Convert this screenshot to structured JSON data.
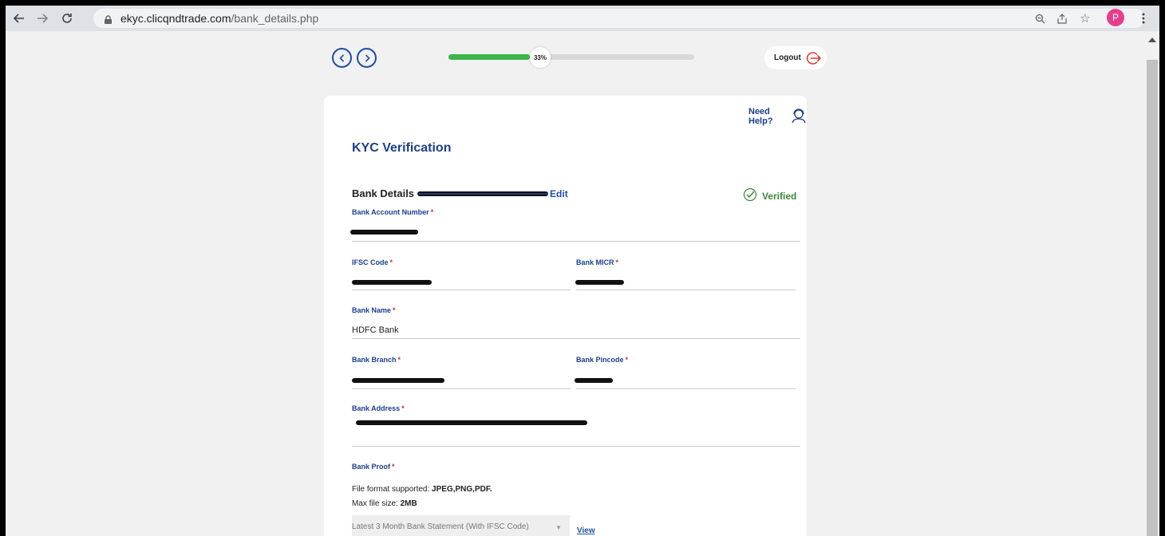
{
  "browser": {
    "url_domain": "ekyc.clicqndtrade.com",
    "url_path": "/bank_details.php",
    "profile_initial": "P"
  },
  "header": {
    "progress_percent": 33,
    "progress_label": "33%",
    "logout_label": "Logout"
  },
  "card": {
    "help_label": "Need Help?",
    "title": "KYC Verification",
    "section_title": "Bank Details",
    "edit_label": "Edit",
    "verified_label": "Verified",
    "fields": {
      "account_number_label": "Bank Account Number",
      "ifsc_label": "IFSC Code",
      "micr_label": "Bank MICR",
      "bank_name_label": "Bank Name",
      "bank_name_value": "HDFC Bank",
      "branch_label": "Bank Branch",
      "pincode_label": "Bank Pincode",
      "address_label": "Bank Address",
      "proof_label": "Bank Proof"
    },
    "file_info": {
      "format_prefix": "File format supported: ",
      "format_value": "JPEG,PNG,PDF.",
      "size_prefix": "Max file size: ",
      "size_value": "2MB"
    },
    "proof_select_value": "Latest 3 Month Bank Statement (With IFSC Code)",
    "view_label": "View"
  },
  "colors": {
    "brand_blue": "#1c3f8c",
    "progress_green": "#3bb54a",
    "verified_green": "#3a8a3a",
    "required_red": "#d32f2f"
  }
}
